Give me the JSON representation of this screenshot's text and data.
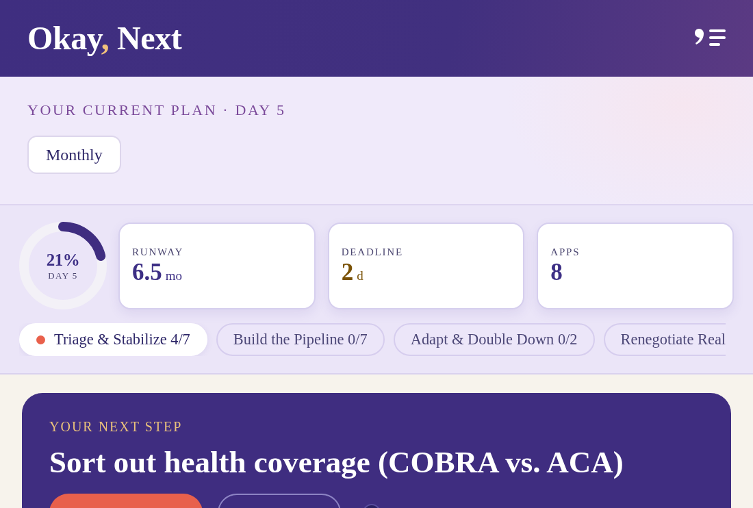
{
  "header": {
    "logo": [
      {
        "text": "Okay",
        "accent": false
      },
      {
        "text": ",",
        "accent": true
      },
      {
        "text": " Next",
        "accent": false
      }
    ]
  },
  "plan": {
    "label": "YOUR CURRENT PLAN · DAY 5",
    "period": "Monthly"
  },
  "progress": {
    "level": 0.21,
    "percent": "21%",
    "caption": "DAY 5"
  },
  "stats": [
    {
      "label": "RUNWAY",
      "value": "6.5",
      "unit": "mo",
      "color": "#3d2f85"
    },
    {
      "label": "DEADLINE",
      "value": "2",
      "unit": "d",
      "color": "#7a5206"
    },
    {
      "label": "APPS",
      "value": "8",
      "color": "#3d2f85"
    }
  ],
  "phases": [
    {
      "label": "Triage & Stabilize 4/7",
      "selected": true
    },
    {
      "label": "Build the Pipeline 0/7",
      "selected": false
    },
    {
      "label": "Adapt & Double Down 0/2",
      "selected": false
    },
    {
      "label": "Renegotiate Real",
      "selected": false
    }
  ],
  "next_step": {
    "label": "YOUR NEXT STEP",
    "title": "Sort out health coverage (COBRA vs. ACA)",
    "actions": [
      {
        "kind": "primary"
      },
      {
        "kind": "secondary"
      },
      {
        "kind": "round"
      }
    ]
  }
}
